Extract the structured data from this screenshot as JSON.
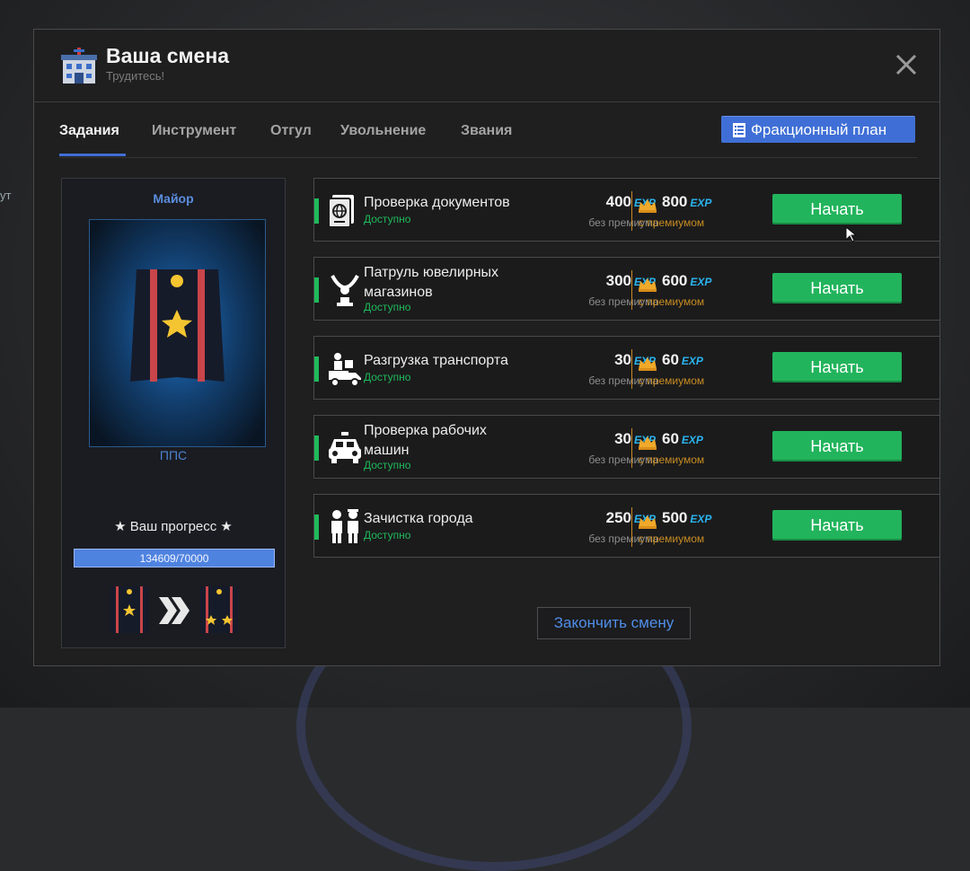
{
  "background": {
    "side_text": "ут"
  },
  "window": {
    "title": "Ваша смена",
    "subtitle": "Трудитесь!",
    "icon": "police-station-icon",
    "close_icon": "close-icon"
  },
  "tabs": [
    {
      "label": "Задания",
      "active": true
    },
    {
      "label": "Инструмент",
      "active": false
    },
    {
      "label": "Отгул",
      "active": false
    },
    {
      "label": "Увольнение",
      "active": false
    },
    {
      "label": "Звания",
      "active": false
    }
  ],
  "faction_plan_button": {
    "label": "Фракционный план",
    "icon": "clipboard-icon"
  },
  "rank_panel": {
    "rank_name": "Майор",
    "unit": "ППС",
    "progress_title": "★ Ваш прогресс ★",
    "progress_text": "134609/70000",
    "progress_fraction": 1.0,
    "next_rank_icon": "double-chevron-right-icon"
  },
  "tasks": [
    {
      "name_lines": [
        "Проверка документов"
      ],
      "status": "Доступно",
      "icon": "passport-icon",
      "exp": "400",
      "exp_unit": "EXP",
      "exp_premium": "800",
      "no_premium_label": "без премиума",
      "premium_label": "с премиумом",
      "button": "Начать"
    },
    {
      "name_lines": [
        "Патруль ювелирных",
        "магазинов"
      ],
      "status": "Доступно",
      "icon": "jewelry-necklace-icon",
      "exp": "300",
      "exp_unit": "EXP",
      "exp_premium": "600",
      "no_premium_label": "без премиума",
      "premium_label": "с премиумом",
      "button": "Начать"
    },
    {
      "name_lines": [
        "Разгрузка транспорта"
      ],
      "status": "Доступно",
      "icon": "delivery-truck-icon",
      "exp": "30",
      "exp_unit": "EXP",
      "exp_premium": "60",
      "no_premium_label": "без премиума",
      "premium_label": "с премиумом",
      "button": "Начать"
    },
    {
      "name_lines": [
        "Проверка рабочих",
        "машин"
      ],
      "status": "Доступно",
      "icon": "police-car-icon",
      "exp": "30",
      "exp_unit": "EXP",
      "exp_premium": "60",
      "no_premium_label": "без премиума",
      "premium_label": "с премиумом",
      "button": "Начать"
    },
    {
      "name_lines": [
        "Зачистка города"
      ],
      "status": "Доступно",
      "icon": "police-officers-icon",
      "exp": "250",
      "exp_unit": "EXP",
      "exp_premium": "500",
      "no_premium_label": "без премиума",
      "premium_label": "с премиумом",
      "button": "Начать"
    }
  ],
  "finish_button": {
    "label": "Закончить смену"
  },
  "colors": {
    "accent_blue": "#3f6fd6",
    "start_green": "#22b45c",
    "premium_gold": "#c68b22",
    "exp_cyan": "#2ab5f0"
  }
}
